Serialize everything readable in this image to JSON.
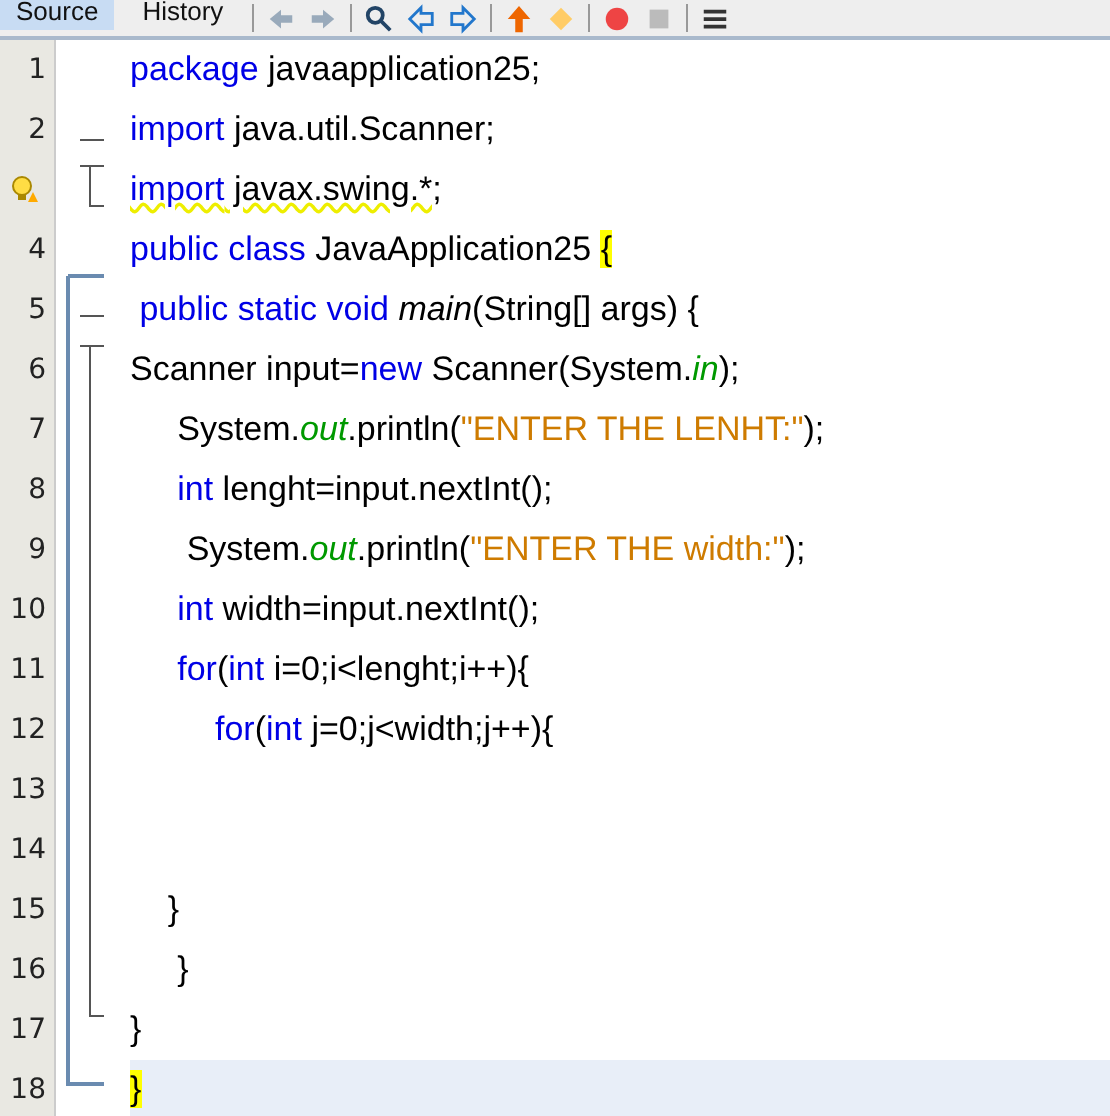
{
  "tabs": [
    {
      "label": "Source",
      "selected": true
    },
    {
      "label": "History",
      "selected": false
    }
  ],
  "lines": [
    {
      "number": "1",
      "warning": false,
      "current": false,
      "tokens": [
        {
          "t": "package",
          "kind": "kw"
        },
        {
          "t": " javaapplication25;",
          "kind": "id"
        }
      ]
    },
    {
      "number": "2",
      "warning": false,
      "current": false,
      "tokens": [
        {
          "t": "import",
          "kind": "kw"
        },
        {
          "t": " java.util.Scanner;",
          "kind": "id"
        }
      ]
    },
    {
      "warning": true,
      "current": false,
      "tokens": [
        {
          "t": "import",
          "kind": "kw"
        },
        {
          "t": " javax.swing.*;",
          "kind": "id"
        }
      ]
    },
    {
      "number": "4",
      "warning": false,
      "current": false,
      "tokens": [
        {
          "t": "public class",
          "kind": "kw"
        },
        {
          "t": " JavaApplication25 ",
          "kind": "id"
        },
        {
          "t": "{",
          "kind": "brace"
        }
      ]
    },
    {
      "number": "5",
      "warning": false,
      "current": false,
      "tokens": [
        {
          "t": " public static void ",
          "kind": "kw"
        },
        {
          "t": "main",
          "kind": "mth"
        },
        {
          "t": "(String[] args) {",
          "kind": "id"
        }
      ]
    },
    {
      "number": "6",
      "warning": false,
      "current": false,
      "tokens": [
        {
          "t": "Scanner input=",
          "kind": "id"
        },
        {
          "t": "new",
          "kind": "kw"
        },
        {
          "t": " Scanner(System.",
          "kind": "id"
        },
        {
          "t": "in",
          "kind": "fld"
        },
        {
          "t": ");",
          "kind": "id"
        }
      ]
    },
    {
      "number": "7",
      "warning": false,
      "current": false,
      "tokens": [
        {
          "t": "     System.",
          "kind": "id"
        },
        {
          "t": "out",
          "kind": "fld"
        },
        {
          "t": ".println(",
          "kind": "id"
        },
        {
          "t": "\"ENTER THE LENHT:\"",
          "kind": "str"
        },
        {
          "t": ");",
          "kind": "id"
        }
      ]
    },
    {
      "number": "8",
      "warning": false,
      "current": false,
      "tokens": [
        {
          "t": "     int",
          "kind": "kw"
        },
        {
          "t": " lenght=input.nextInt();",
          "kind": "id"
        }
      ]
    },
    {
      "number": "9",
      "warning": false,
      "current": false,
      "tokens": [
        {
          "t": "      System.",
          "kind": "id"
        },
        {
          "t": "out",
          "kind": "fld"
        },
        {
          "t": ".println(",
          "kind": "id"
        },
        {
          "t": "\"ENTER THE width:\"",
          "kind": "str"
        },
        {
          "t": ");",
          "kind": "id"
        }
      ]
    },
    {
      "number": "10",
      "warning": false,
      "current": false,
      "tokens": [
        {
          "t": "     int",
          "kind": "kw"
        },
        {
          "t": " width=input.nextInt();",
          "kind": "id"
        }
      ]
    },
    {
      "number": "11",
      "warning": false,
      "current": false,
      "tokens": [
        {
          "t": "     for",
          "kind": "kw"
        },
        {
          "t": "(",
          "kind": "id"
        },
        {
          "t": "int",
          "kind": "kw"
        },
        {
          "t": " i=0;i<lenght;i++){",
          "kind": "id"
        }
      ]
    },
    {
      "number": "12",
      "warning": false,
      "current": false,
      "tokens": [
        {
          "t": "         for",
          "kind": "kw"
        },
        {
          "t": "(",
          "kind": "id"
        },
        {
          "t": "int",
          "kind": "kw"
        },
        {
          "t": " j=0;j<width;j++){",
          "kind": "id"
        }
      ]
    },
    {
      "number": "13",
      "warning": false,
      "current": false
    },
    {
      "number": "14",
      "warning": false,
      "current": false
    },
    {
      "number": "15",
      "warning": false,
      "current": false,
      "tokens": [
        {
          "t": "    }",
          "kind": "id"
        }
      ]
    },
    {
      "number": "16",
      "warning": false,
      "current": false,
      "tokens": [
        {
          "t": "     }",
          "kind": "id"
        }
      ]
    },
    {
      "number": "17",
      "warning": false,
      "current": false,
      "tokens": [
        {
          "t": "}",
          "kind": "id"
        }
      ]
    },
    {
      "number": "18",
      "warning": false,
      "current": true,
      "tokens": [
        {
          "t": "}",
          "kind": "brace"
        }
      ]
    }
  ]
}
